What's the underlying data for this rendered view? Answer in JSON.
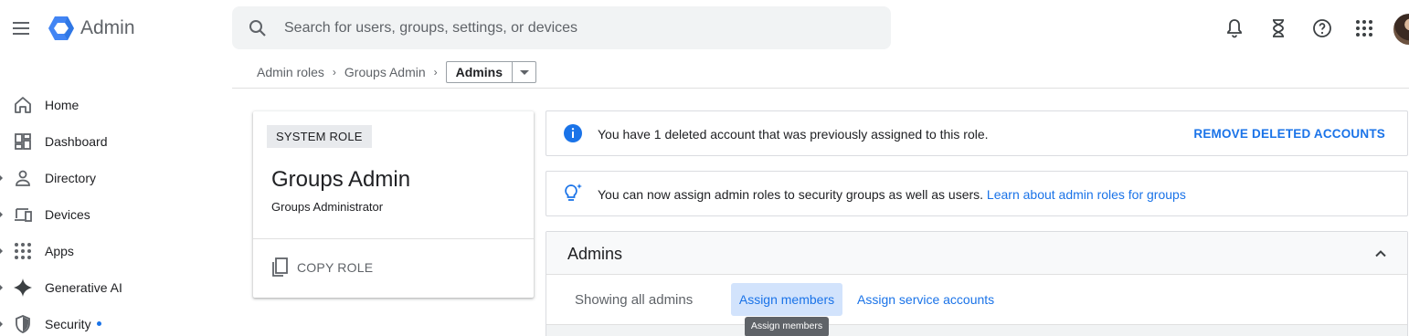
{
  "header": {
    "app_name": "Admin",
    "search_placeholder": "Search for users, groups, settings, or devices"
  },
  "breadcrumb": {
    "items": [
      "Admin roles",
      "Groups Admin"
    ],
    "current": "Admins"
  },
  "sidebar": {
    "items": [
      {
        "label": "Home",
        "icon": "home-icon"
      },
      {
        "label": "Dashboard",
        "icon": "dashboard-icon"
      },
      {
        "label": "Directory",
        "icon": "person-icon"
      },
      {
        "label": "Devices",
        "icon": "devices-icon"
      },
      {
        "label": "Apps",
        "icon": "apps-grid-icon"
      },
      {
        "label": "Generative AI",
        "icon": "sparkle-icon"
      },
      {
        "label": "Security",
        "icon": "shield-icon"
      }
    ]
  },
  "role_card": {
    "chip": "SYSTEM ROLE",
    "title": "Groups Admin",
    "subtitle": "Groups Administrator",
    "copy_label": "COPY ROLE"
  },
  "banners": {
    "deleted": {
      "text": "You have 1 deleted account that was previously assigned to this role.",
      "action": "REMOVE DELETED ACCOUNTS"
    },
    "groups": {
      "text": "You can now assign admin roles to security groups as well as users.",
      "link": "Learn about admin roles for groups"
    }
  },
  "admins": {
    "title": "Admins",
    "showing": "Showing all admins",
    "assign_members": "Assign members",
    "assign_service_accounts": "Assign service accounts",
    "tooltip": "Assign members"
  },
  "colors": {
    "accent": "#1a73e8",
    "accent_light": "#d2e3fc",
    "logo": "#4285f4"
  }
}
